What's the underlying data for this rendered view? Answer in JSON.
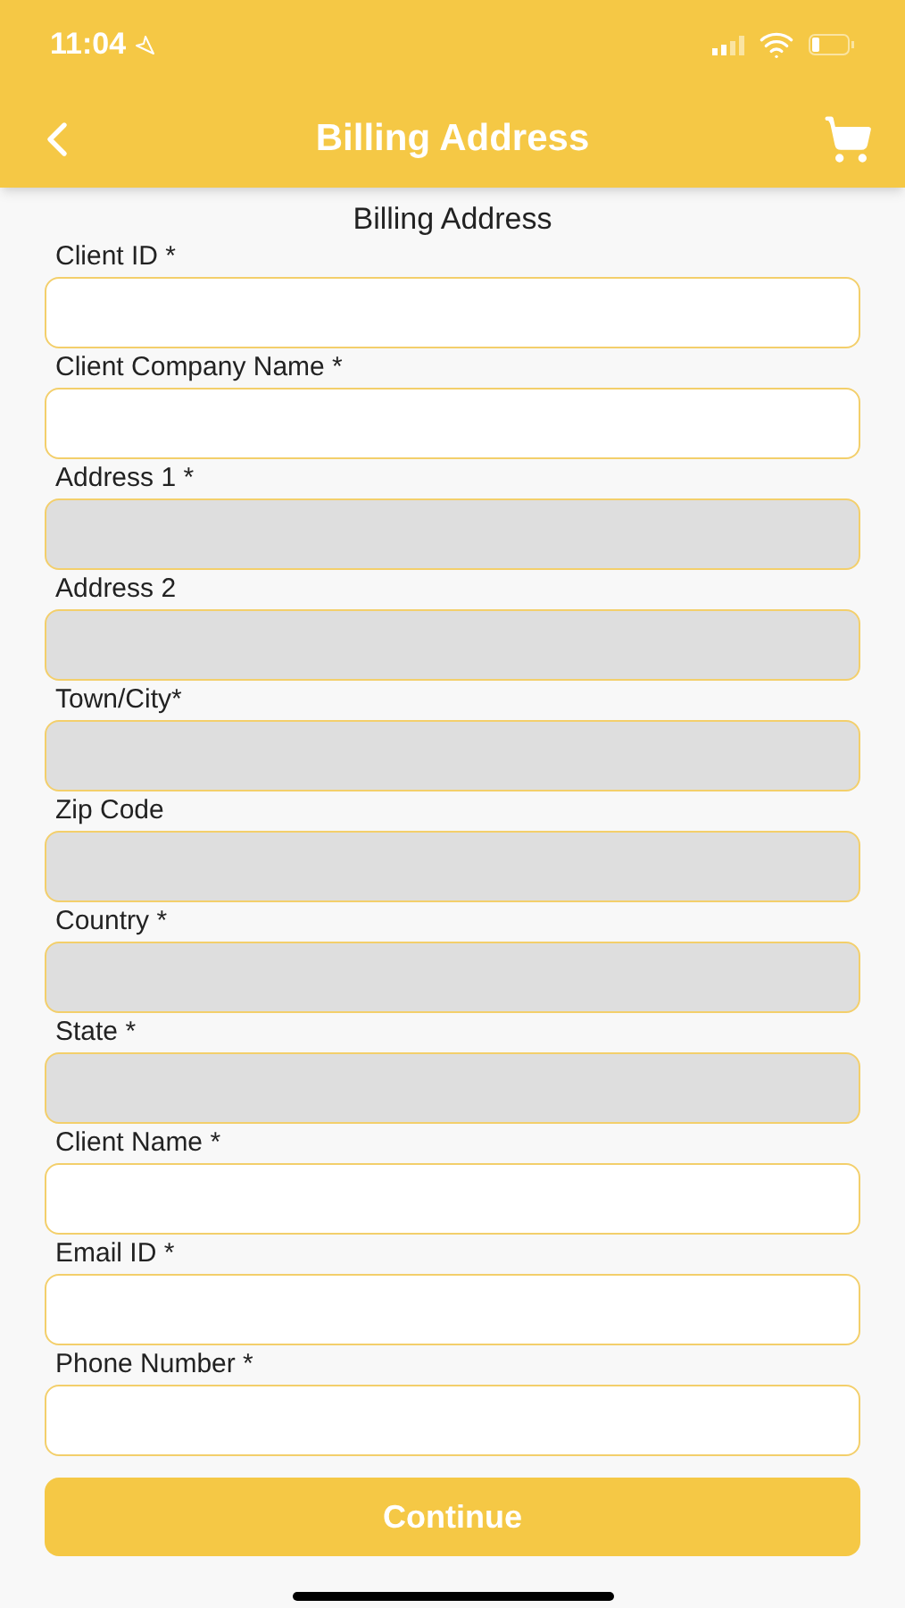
{
  "status_bar": {
    "time": "11:04"
  },
  "header": {
    "title": "Billing Address"
  },
  "form": {
    "heading": "Billing Address",
    "fields": [
      {
        "label": "Client ID *",
        "disabled": false
      },
      {
        "label": "Client Company Name *",
        "disabled": false
      },
      {
        "label": "Address 1 *",
        "disabled": true
      },
      {
        "label": "Address 2",
        "disabled": true
      },
      {
        "label": "Town/City*",
        "disabled": true
      },
      {
        "label": "Zip Code",
        "disabled": true
      },
      {
        "label": "Country *",
        "disabled": true
      },
      {
        "label": "State *",
        "disabled": true
      },
      {
        "label": "Client Name *",
        "disabled": false
      },
      {
        "label": "Email ID *",
        "disabled": false
      },
      {
        "label": "Phone Number *",
        "disabled": false
      }
    ],
    "submit": "Continue"
  }
}
